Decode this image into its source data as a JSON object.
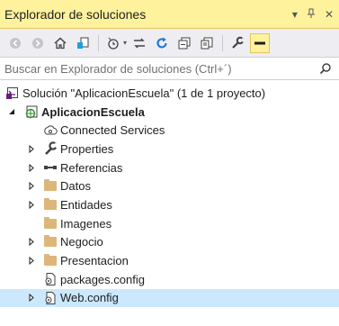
{
  "window": {
    "title": "Explorador de soluciones",
    "dropdown_glyph": "▾",
    "pin_glyph": "ꟷ",
    "close_glyph": "✕"
  },
  "toolbar": {
    "buttons": [
      {
        "icon": "back-icon"
      },
      {
        "icon": "forward-icon"
      },
      {
        "icon": "home-icon"
      },
      {
        "icon": "switch-views-icon"
      },
      {
        "icon": "pending-changes-filter-icon"
      },
      {
        "icon": "sync-with-active-document-icon"
      },
      {
        "icon": "refresh-icon"
      },
      {
        "icon": "collapse-all-icon"
      },
      {
        "icon": "show-all-files-icon"
      },
      {
        "icon": "properties-icon"
      },
      {
        "icon": "preview-selected-items-icon"
      }
    ],
    "dropdown_glyph": "▾"
  },
  "search": {
    "placeholder": "Buscar en Explorador de soluciones (Ctrl+´)",
    "value": ""
  },
  "tree": [
    {
      "label": "Solución \"AplicacionEscuela\" (1 de 1 proyecto)",
      "icon": "solution-icon",
      "level": 0,
      "expander": "none",
      "bold": false
    },
    {
      "label": "AplicacionEscuela",
      "icon": "web-project-icon",
      "level": 1,
      "expander": "expanded",
      "bold": true
    },
    {
      "label": "Connected Services",
      "icon": "connected-services-icon",
      "level": 2,
      "expander": "none",
      "bold": false
    },
    {
      "label": "Properties",
      "icon": "wrench-icon",
      "level": 2,
      "expander": "collapsed",
      "bold": false
    },
    {
      "label": "Referencias",
      "icon": "references-icon",
      "level": 2,
      "expander": "collapsed",
      "bold": false
    },
    {
      "label": "Datos",
      "icon": "folder-icon",
      "level": 2,
      "expander": "collapsed",
      "bold": false
    },
    {
      "label": "Entidades",
      "icon": "folder-icon",
      "level": 2,
      "expander": "collapsed",
      "bold": false
    },
    {
      "label": "Imagenes",
      "icon": "folder-icon",
      "level": 2,
      "expander": "none",
      "bold": false
    },
    {
      "label": "Negocio",
      "icon": "folder-icon",
      "level": 2,
      "expander": "collapsed",
      "bold": false
    },
    {
      "label": "Presentacion",
      "icon": "folder-icon",
      "level": 2,
      "expander": "collapsed",
      "bold": false
    },
    {
      "label": "packages.config",
      "icon": "config-file-icon",
      "level": 2,
      "expander": "none",
      "bold": false
    },
    {
      "label": "Web.config",
      "icon": "config-file-icon",
      "level": 2,
      "expander": "collapsed",
      "bold": false,
      "selected": true
    }
  ],
  "colors": {
    "title_bar": "#fff29d",
    "toolbar": "#eeeef2",
    "selection": "#cce8ff",
    "folder": "#dcb67a"
  }
}
